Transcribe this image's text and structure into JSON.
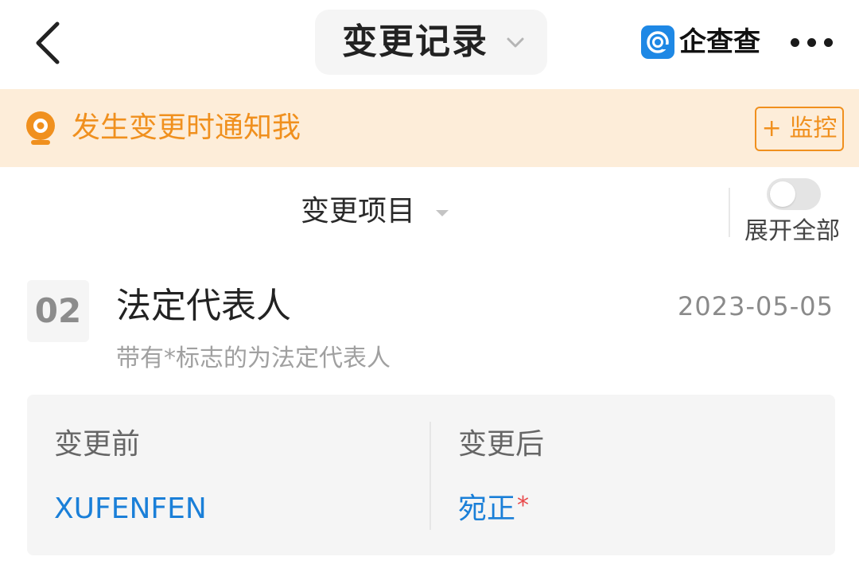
{
  "nav": {
    "title": "变更记录",
    "brand_name": "企查查"
  },
  "banner": {
    "text": "发生变更时通知我",
    "monitor_button": "+ 监控"
  },
  "filter": {
    "label": "变更项目",
    "toggle_label": "展开全部",
    "toggle_on": false
  },
  "record": {
    "index": "02",
    "title": "法定代表人",
    "date": "2023-05-05",
    "note": "带有*标志的为法定代表人",
    "before_label": "变更前",
    "before_value": "XUFENFEN",
    "after_label": "变更后",
    "after_value": "宛正",
    "after_marker": "*"
  },
  "colors": {
    "accent_orange": "#f0901e",
    "banner_bg": "#fdedd9",
    "link_blue": "#1a7fd8",
    "marker_red": "#e8484a",
    "brand_blue": "#1e88e5"
  }
}
